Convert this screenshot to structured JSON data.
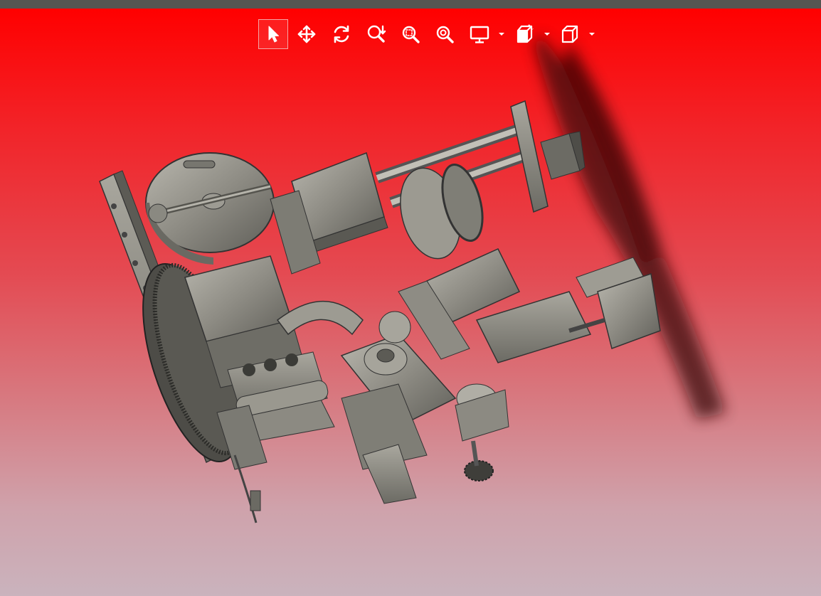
{
  "window": {
    "title": ""
  },
  "toolbar": {
    "tools": [
      {
        "id": "select",
        "icon": "cursor-arrow-icon",
        "active": true
      },
      {
        "id": "pan",
        "icon": "move-arrows-icon",
        "active": false
      },
      {
        "id": "rotate",
        "icon": "rotate-icon",
        "active": false
      },
      {
        "id": "zoom",
        "icon": "zoom-updown-icon",
        "active": false
      },
      {
        "id": "zoom-window",
        "icon": "zoom-window-icon",
        "active": false
      },
      {
        "id": "zoom-fit",
        "icon": "zoom-fit-icon",
        "active": false
      },
      {
        "id": "display",
        "icon": "monitor-icon",
        "has_dropdown": true
      },
      {
        "id": "section",
        "icon": "section-view-icon",
        "has_dropdown": true
      },
      {
        "id": "view-orientation",
        "icon": "cube-view-icon",
        "has_dropdown": true
      }
    ]
  },
  "viewport": {
    "background_top": "#ff0000",
    "background_bottom": "#cab3bd",
    "model_color": "#8e8c84"
  }
}
